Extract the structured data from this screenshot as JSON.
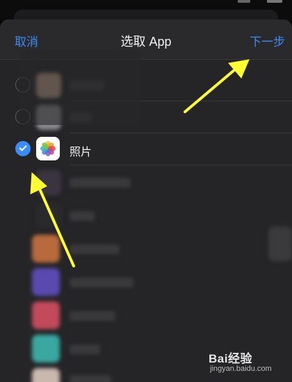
{
  "nav": {
    "cancel_label": "取消",
    "title": "选取 App",
    "next_label": "下一步"
  },
  "selected_app": {
    "label": "照片",
    "selected": true
  },
  "watermark": {
    "brand": "Bai经验",
    "sub": "jingyan.baidu.com"
  },
  "colors": {
    "accent": "#3c8cf5",
    "sheet_bg": "#252527",
    "arrow": "#ffff33"
  }
}
